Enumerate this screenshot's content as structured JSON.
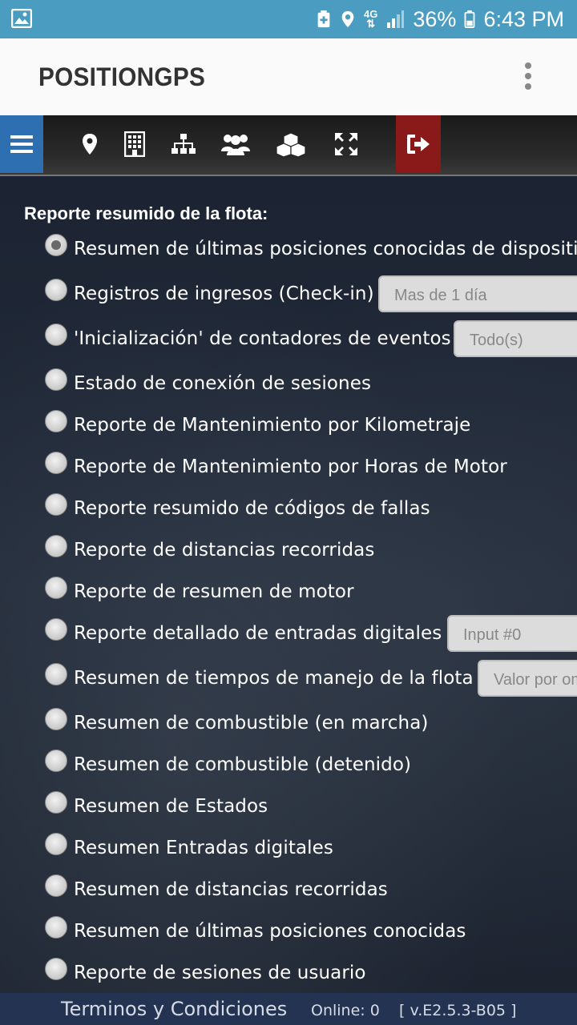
{
  "status_bar": {
    "battery": "36%",
    "time": "6:43 PM",
    "network": "4G",
    "icons": [
      "gallery-icon",
      "battery-saver-icon",
      "location-icon",
      "signal-icon",
      "battery-icon"
    ]
  },
  "app_bar": {
    "title": "POSITIONGPS",
    "more_icon": "more-vert-icon"
  },
  "toolbar": {
    "accent_menu": "#2e6fb2",
    "accent_exit": "#8a1a1a",
    "icons": [
      "menu-icon",
      "map-marker-icon",
      "building-icon",
      "sitemap-icon",
      "users-icon",
      "cubes-icon",
      "arrows-expand-icon",
      "sign-out-icon"
    ]
  },
  "main": {
    "section_title": "Reporte resumido de la flota:",
    "options": [
      {
        "label": "Resumen de últimas posiciones conocidas de dispositivos",
        "checked": true
      },
      {
        "label": "Registros de ingresos (Check-in)",
        "select": "Mas de 1 día"
      },
      {
        "label": "'Inicialización' de contadores de eventos",
        "select": "Todo(s)"
      },
      {
        "label": "Estado de conexión de sesiones"
      },
      {
        "label": "Reporte de Mantenimiento por Kilometraje"
      },
      {
        "label": "Reporte de Mantenimiento por Horas de Motor"
      },
      {
        "label": "Reporte resumido de códigos de fallas"
      },
      {
        "label": "Reporte de distancias recorridas"
      },
      {
        "label": "Reporte de resumen de motor"
      },
      {
        "label": "Reporte detallado de entradas digitales",
        "select": "Input #0"
      },
      {
        "label": "Resumen de tiempos de manejo de la flota",
        "select": "Valor por omisión"
      },
      {
        "label": "Resumen de combustible (en marcha)"
      },
      {
        "label": "Resumen de combustible (detenido)"
      },
      {
        "label": "Resumen de Estados"
      },
      {
        "label": "Resumen Entradas digitales"
      },
      {
        "label": "Resumen de distancias recorridas"
      },
      {
        "label": "Resumen de últimas posiciones conocidas"
      },
      {
        "label": "Reporte de sesiones de usuario"
      }
    ]
  },
  "footer": {
    "terms": "Terminos y Condiciones",
    "online": "Online: 0",
    "version": "[ v.E2.5.3-B05 ]"
  }
}
